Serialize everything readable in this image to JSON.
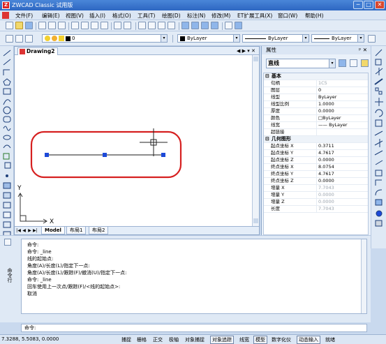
{
  "window": {
    "title": "ZWCAD Classic 试用版",
    "logo_letter": "Z",
    "minimize_glyph": "─",
    "maximize_glyph": "□",
    "close_glyph": "✕"
  },
  "menu": [
    "文件(F)",
    "编辑(E)",
    "视图(V)",
    "插入(I)",
    "格式(O)",
    "工具(T)",
    "绘图(D)",
    "标注(N)",
    "修改(M)",
    "ET扩展工具(X)",
    "窗口(W)",
    "帮助(H)"
  ],
  "toolbar2": {
    "layer_value": "0",
    "color_value": "ByLayer",
    "linetype_value": "ByLayer",
    "lineweight_value": "ByLayer"
  },
  "drawing": {
    "tab_label": "Drawing2",
    "tab_controls": "◀ ▶ ▾ ✕",
    "axis_y": "Y",
    "axis_x": "X",
    "layout_tabs": [
      "Model",
      "布局1",
      "布局2"
    ],
    "nav_glyphs": [
      "|◀",
      "◀",
      "▶",
      "▶|"
    ],
    "highlight_color": "#d62020",
    "grip_color": "#1d49d8"
  },
  "properties": {
    "header": "属性",
    "header_controls": "ᵖ ✕",
    "selected": "直线",
    "dropdown_glyph": "▾",
    "groups": [
      {
        "title": "基本",
        "toggle": "⊟",
        "rows": [
          {
            "k": "句柄",
            "v": "1C5",
            "gray": true
          },
          {
            "k": "图层",
            "v": "0"
          },
          {
            "k": "线型",
            "v": "ByLayer"
          },
          {
            "k": "线型比例",
            "v": "1.0000"
          },
          {
            "k": "厚度",
            "v": "0.0000"
          },
          {
            "k": "颜色",
            "v": "□ByLayer"
          },
          {
            "k": "线宽",
            "v": "—— ByLayer"
          },
          {
            "k": "超链接",
            "v": ""
          }
        ]
      },
      {
        "title": "几何图形",
        "toggle": "⊟",
        "rows": [
          {
            "k": "起点坐标 X",
            "v": "0.3711"
          },
          {
            "k": "起点坐标 Y",
            "v": "4.7617"
          },
          {
            "k": "起点坐标 Z",
            "v": "0.0000"
          },
          {
            "k": "终点坐标 X",
            "v": "8.0754"
          },
          {
            "k": "终点坐标 Y",
            "v": "4.7617"
          },
          {
            "k": "终点坐标 Z",
            "v": "0.0000"
          },
          {
            "k": "增量 X",
            "v": "7.7043",
            "gray": true
          },
          {
            "k": "增量 Y",
            "v": "0.0000",
            "gray": true
          },
          {
            "k": "增量 Z",
            "v": "0.0000",
            "gray": true
          },
          {
            "k": "长度",
            "v": "7.7043",
            "gray": true
          }
        ]
      }
    ]
  },
  "command": {
    "label": "命令行",
    "history": [
      "命令:",
      "命令: _line",
      "线的起始点:",
      "角度(A)/长度(L)/指定下一点:",
      "角度(A)/长度(L)/跟踪(F)/撤消(U)/指定下一点:",
      "命令: _line",
      "回车使用上一次点/跟踪(F)/<线的起始点>:",
      "取消"
    ],
    "prompt": "命令:"
  },
  "status": {
    "coords": "7.3288, 5.5083, 0.0000",
    "buttons": [
      {
        "label": "捕捉",
        "on": false
      },
      {
        "label": "栅格",
        "on": false
      },
      {
        "label": "正交",
        "on": false
      },
      {
        "label": "极轴",
        "on": false
      },
      {
        "label": "对象捕捉",
        "on": false
      },
      {
        "label": "对象追踪",
        "on": true
      },
      {
        "label": "线宽",
        "on": false
      },
      {
        "label": "模型",
        "on": true
      },
      {
        "label": "数字化仪",
        "on": false
      },
      {
        "label": "动态输入",
        "on": true
      },
      {
        "label": "就绪",
        "on": false
      }
    ]
  }
}
